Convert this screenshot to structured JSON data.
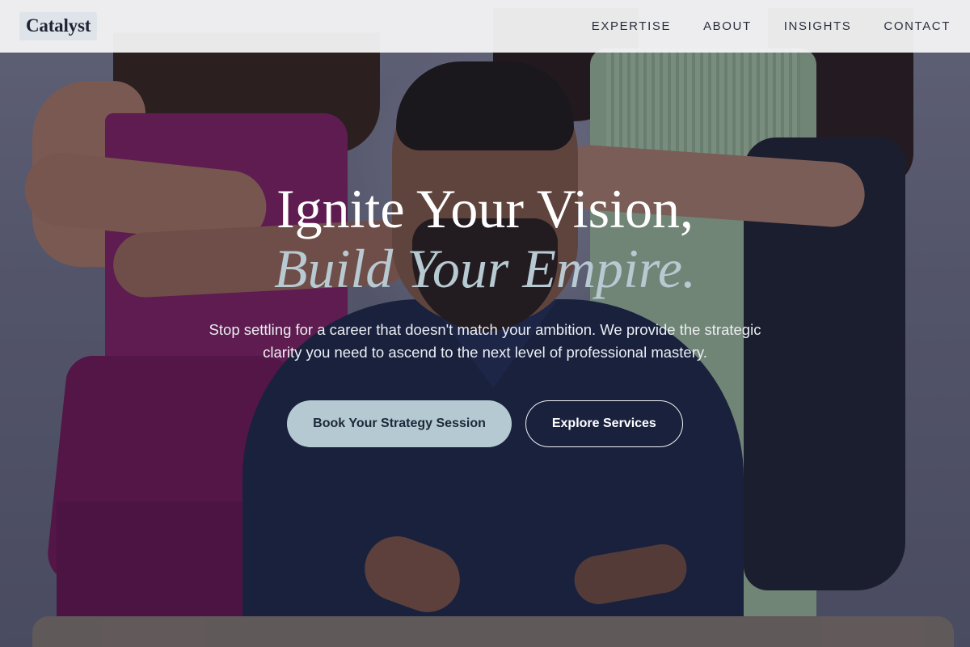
{
  "brand": {
    "logo_text": "Catalyst"
  },
  "nav": {
    "items": [
      {
        "label": "EXPERTISE"
      },
      {
        "label": "ABOUT"
      },
      {
        "label": "INSIGHTS"
      },
      {
        "label": "CONTACT"
      }
    ]
  },
  "hero": {
    "headline_line1": "Ignite Your Vision,",
    "headline_line2": "Build Your Empire.",
    "subtext": "Stop settling for a career that doesn't match your ambition. We provide the strategic clarity you need to ascend to the next level of professional mastery.",
    "primary_cta": "Book Your Strategy Session",
    "secondary_cta": "Explore Services"
  },
  "colors": {
    "accent": "#b5c9d2",
    "headline_italic": "#b7c9d1",
    "nav_bg": "#f4f4f6",
    "text_dark": "#1d2433"
  }
}
